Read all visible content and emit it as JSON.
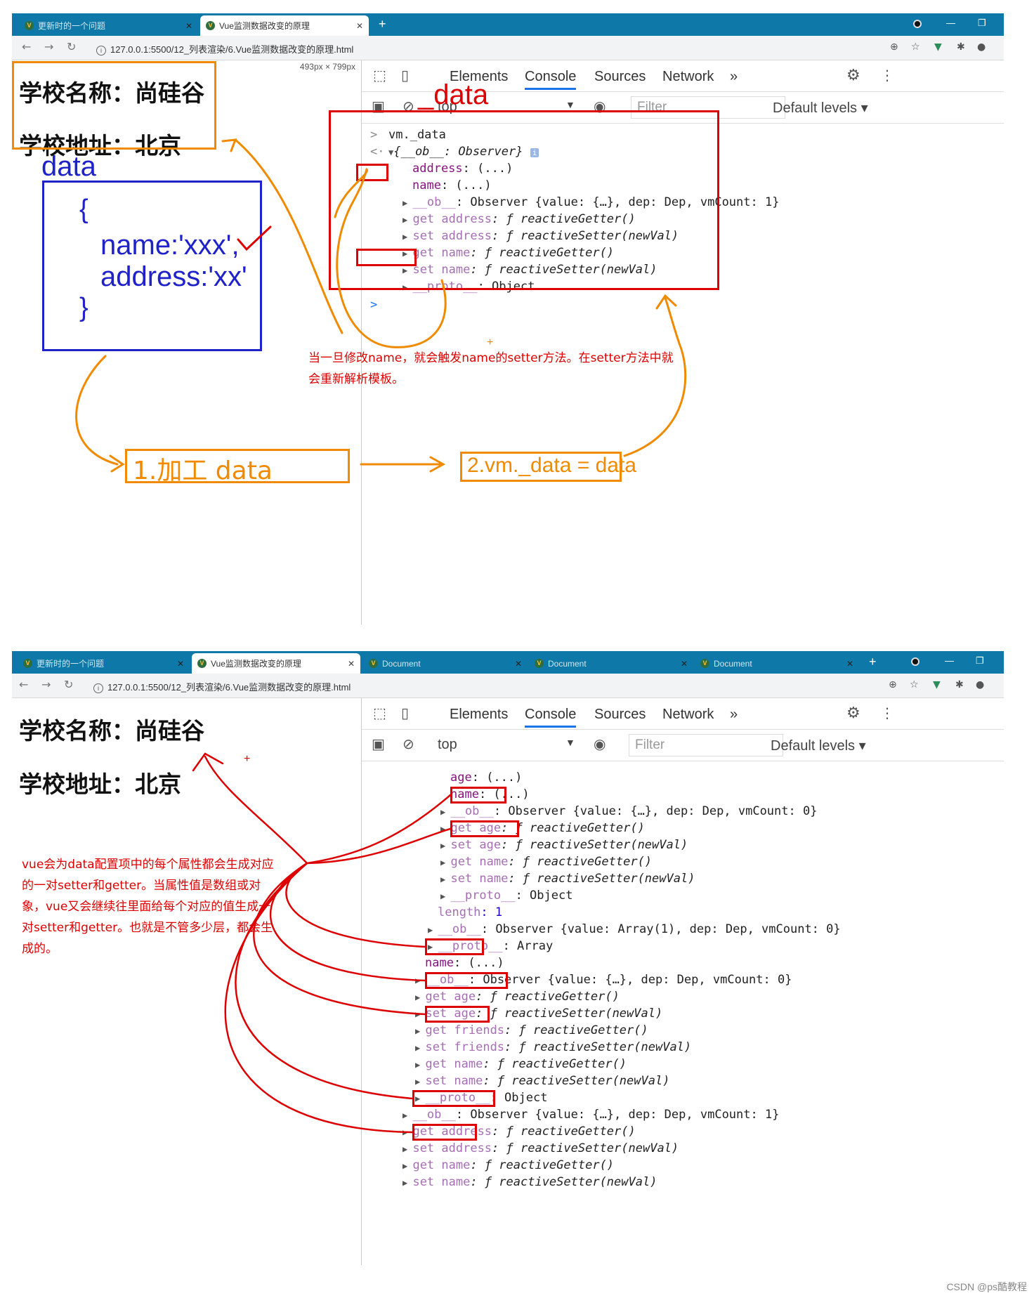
{
  "screenshot_top": {
    "tabs": [
      {
        "label": "更新时的一个问题",
        "active": false
      },
      {
        "label": "Vue监测数据改变的原理",
        "active": true
      }
    ],
    "url": "127.0.0.1:5500/12_列表渲染/6.Vue监测数据改变的原理.html",
    "page": {
      "size_badge": "493px × 799px",
      "school_name": "学校名称：尚硅谷",
      "school_address": "学校地址：北京",
      "data_label": "data",
      "code_open": "{",
      "code_name": "name:'xxx',",
      "code_address": "address:'xx'",
      "code_close": "}",
      "step1": "1.加工 data",
      "step2": "2.vm._data = data"
    },
    "devtools": {
      "tabs": [
        "Elements",
        "Console",
        "Sources",
        "Network",
        "»"
      ],
      "selected_tab": "Console",
      "context": "top",
      "context_annotation": "_data",
      "filter_placeholder": "Filter",
      "levels": "Default levels ▾",
      "command": "vm._data",
      "result": "{__ob__: Observer}",
      "lines": [
        {
          "key": "address",
          "rest": ": (...)"
        },
        {
          "key": "name",
          "rest": ": (...)"
        },
        {
          "key": "__ob__",
          "rest": ": Observer {value: {…}, dep: Dep, vmCount: 1}"
        },
        {
          "key": "get address",
          "rest": ": ƒ reactiveGetter()"
        },
        {
          "key": "set address",
          "rest": ": ƒ reactiveSetter(newVal)"
        },
        {
          "key": "get name",
          "rest": ": ƒ reactiveGetter()"
        },
        {
          "key": "set name",
          "rest": ": ƒ reactiveSetter(newVal)"
        },
        {
          "key": "__proto__",
          "rest": ": Object"
        }
      ]
    },
    "annotation": "当一旦修改name，就会触发name的setter方法。在setter方法中就会重新解析模板。"
  },
  "screenshot_bottom": {
    "tabs": [
      {
        "label": "更新时的一个问题",
        "active": false
      },
      {
        "label": "Vue监测数据改变的原理",
        "active": true
      },
      {
        "label": "Document",
        "active": false
      },
      {
        "label": "Document",
        "active": false
      },
      {
        "label": "Document",
        "active": false
      }
    ],
    "url": "127.0.0.1:5500/12_列表渲染/6.Vue监测数据改变的原理.html",
    "page": {
      "school_name": "学校名称：尚硅谷",
      "school_address": "学校地址：北京"
    },
    "devtools": {
      "tabs": [
        "Elements",
        "Console",
        "Sources",
        "Network",
        "»"
      ],
      "selected_tab": "Console",
      "context": "top",
      "filter_placeholder": "Filter",
      "levels": "Default levels ▾",
      "lines": [
        {
          "key": "age",
          "rest": ": (...)"
        },
        {
          "key": "name",
          "rest": ": (...)"
        },
        {
          "key": "__ob__",
          "rest": ": Observer {value: {…}, dep: Dep, vmCount: 0}"
        },
        {
          "key": "get age",
          "rest": ": ƒ reactiveGetter()"
        },
        {
          "key": "set age",
          "rest": ": ƒ reactiveSetter(newVal)"
        },
        {
          "key": "get name",
          "rest": ": ƒ reactiveGetter()"
        },
        {
          "key": "set name",
          "rest": ": ƒ reactiveSetter(newVal)"
        },
        {
          "key": "__proto__",
          "rest": ": Object"
        },
        {
          "key": "length",
          "rest": ": 1"
        },
        {
          "key": "__ob__",
          "rest": ": Observer {value: Array(1), dep: Dep, vmCount: 0}"
        },
        {
          "key": "__proto__",
          "rest": ": Array"
        },
        {
          "key": "name",
          "rest": ": (...)"
        },
        {
          "key": "__ob__",
          "rest": ": Observer {value: {…}, dep: Dep, vmCount: 0}"
        },
        {
          "key": "get age",
          "rest": ": ƒ reactiveGetter()"
        },
        {
          "key": "set age",
          "rest": ": ƒ reactiveSetter(newVal)"
        },
        {
          "key": "get friends",
          "rest": ": ƒ reactiveGetter()"
        },
        {
          "key": "set friends",
          "rest": ": ƒ reactiveSetter(newVal)"
        },
        {
          "key": "get name",
          "rest": ": ƒ reactiveGetter()"
        },
        {
          "key": "set name",
          "rest": ": ƒ reactiveSetter(newVal)"
        },
        {
          "key": "__proto__",
          "rest": ": Object"
        },
        {
          "key": "__ob__",
          "rest": ": Observer {value: {…}, dep: Dep, vmCount: 1}"
        },
        {
          "key": "get address",
          "rest": ": ƒ reactiveGetter()"
        },
        {
          "key": "set address",
          "rest": ": ƒ reactiveSetter(newVal)"
        },
        {
          "key": "get name",
          "rest": ": ƒ reactiveGetter()"
        },
        {
          "key": "set name",
          "rest": ": ƒ reactiveSetter(newVal)"
        }
      ]
    },
    "annotation": "vue会为data配置项中的每个属性都会生成对应的一对setter和getter。当属性值是数组或对象，vue又会继续往里面给每个对应的值生成一对setter和getter。也就是不管多少层，都会生成的。"
  },
  "watermark": "CSDN @ps酷教程",
  "colors": {
    "tabbar": "#0e79a8",
    "annotation_orange": "#f08a00",
    "annotation_blue": "#1f22c9",
    "annotation_red": "#dd0000",
    "key_purple": "#881280",
    "number_blue": "#1c00cf"
  }
}
